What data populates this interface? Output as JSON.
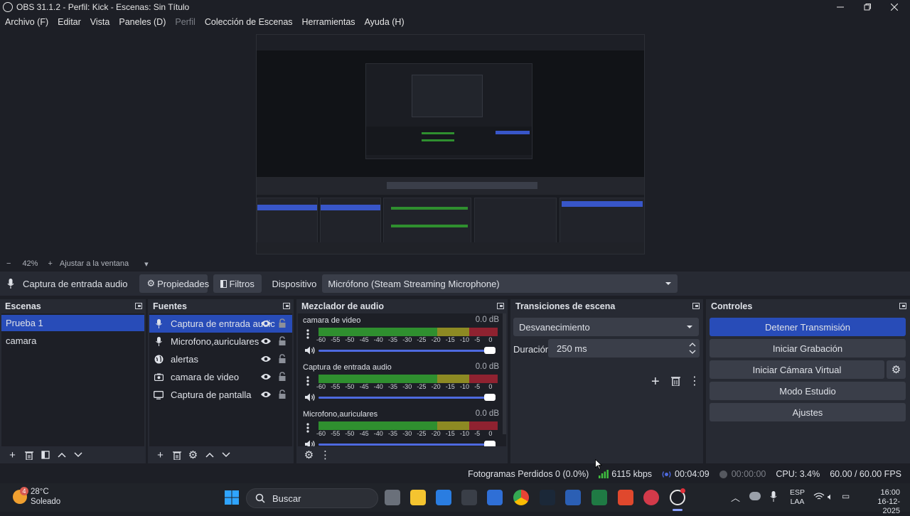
{
  "window": {
    "title": "OBS 31.1.2 - Perfil: Kick - Escenas: Sin Título"
  },
  "menu": [
    "Archivo (F)",
    "Editar",
    "Vista",
    "Paneles (D)",
    "Perfil",
    "Colección de Escenas",
    "Herramientas",
    "Ayuda (H)"
  ],
  "zoom": {
    "minus": "−",
    "value": "42%",
    "plus": "+",
    "fit_label": "Ajustar a la ventana"
  },
  "source_toolbar": {
    "source_name": "Captura de entrada audio",
    "properties": "Propiedades",
    "filters": "Filtros",
    "device_label": "Dispositivo",
    "device_value": "Micrófono (Steam Streaming Microphone)"
  },
  "scenes": {
    "title": "Escenas",
    "items": [
      "Prueba 1",
      "camara"
    ]
  },
  "sources": {
    "title": "Fuentes",
    "items": [
      "Captura de entrada audic",
      "Microfono,auriculares",
      "alertas",
      "camara de video",
      "Captura de pantalla"
    ]
  },
  "mixer": {
    "title": "Mezclador de audio",
    "channels": [
      {
        "name": "camara de video",
        "db": "0.0 dB"
      },
      {
        "name": "Captura de entrada audio",
        "db": "0.0 dB"
      },
      {
        "name": "Microfono,auriculares",
        "db": "0.0 dB"
      }
    ],
    "ticks": [
      "-60",
      "-55",
      "-50",
      "-45",
      "-40",
      "-35",
      "-30",
      "-25",
      "-20",
      "-15",
      "-10",
      "-5",
      "0"
    ]
  },
  "transitions": {
    "title": "Transiciones de escena",
    "selected": "Desvanecimiento",
    "duration_label": "Duración",
    "duration_value": "250 ms"
  },
  "controls": {
    "title": "Controles",
    "buttons": [
      "Detener Transmisión",
      "Iniciar Grabación",
      "Iniciar Cámara Virtual",
      "Modo Estudio",
      "Ajustes"
    ]
  },
  "status": {
    "dropped": "Fotogramas Perdidos 0 (0.0%)",
    "bitrate": "6115 kbps",
    "stream_time": "00:04:09",
    "rec_time": "00:00:00",
    "cpu": "CPU: 3.4%",
    "fps": "60.00 / 60.00 FPS"
  },
  "taskbar": {
    "weather_temp": "28°C",
    "weather_desc": "Soleado",
    "weather_badge": "4",
    "search": "Buscar",
    "lang1": "ESP",
    "lang2": "LAA",
    "time": "16:00",
    "date": "16-12-2025"
  },
  "colors": {
    "accent": "#284cb8",
    "panel": "#272a33",
    "background": "#1d1f26",
    "meter_green": "#2f8f2f",
    "meter_yellow": "#8d8a23",
    "meter_red": "#8f2230"
  }
}
